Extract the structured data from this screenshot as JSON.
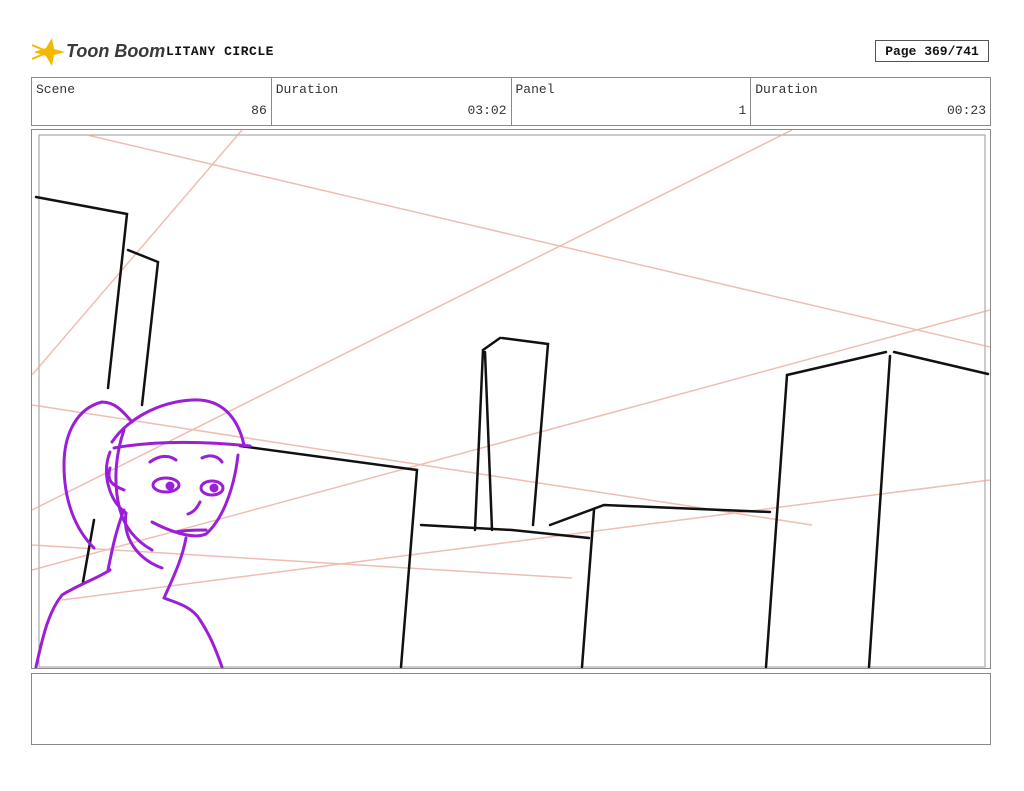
{
  "header": {
    "logo_text": "Toon Boom",
    "project_title": "LITANY CIRCLE",
    "page_label": "Page 369/741"
  },
  "info": {
    "scene_label": "Scene",
    "scene_value": "86",
    "scene_duration_label": "Duration",
    "scene_duration_value": "03:02",
    "panel_label": "Panel",
    "panel_value": "1",
    "panel_duration_label": "Duration",
    "panel_duration_value": "00:23"
  },
  "colors": {
    "ink": "#111111",
    "character": "#9b1fd6",
    "guides": "#e9a89a",
    "logo_accent": "#f5b800"
  },
  "icons": {
    "logo": "toon-boom-star-icon"
  },
  "notes": {
    "text": ""
  }
}
